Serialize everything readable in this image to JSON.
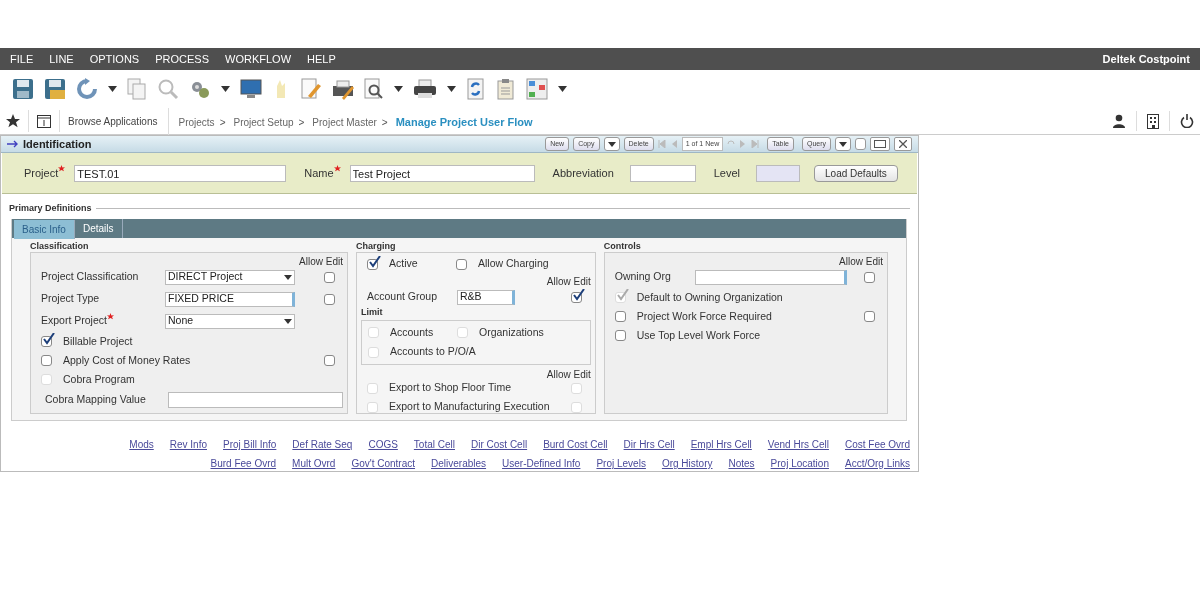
{
  "menu": [
    "FILE",
    "LINE",
    "OPTIONS",
    "PROCESS",
    "WORKFLOW",
    "HELP"
  ],
  "app_name": "Deltek Costpoint",
  "breadcrumb": {
    "browse": "Browse Applications",
    "path": [
      "Projects",
      "Project Setup",
      "Project Master"
    ],
    "separator": ">",
    "current": "Manage Project User Flow"
  },
  "identification": {
    "title": "Identification",
    "edit_buttons": [
      "New",
      "Copy",
      "Delete"
    ],
    "record": "1 of 1 New",
    "view_buttons": [
      "Table",
      "Query"
    ]
  },
  "header_fields": [
    {
      "label": "Project",
      "required": true,
      "value": "TEST.01",
      "disabled": false
    },
    {
      "label": "Name",
      "required": true,
      "value": "Test Project",
      "disabled": false
    },
    {
      "label": "Abbreviation",
      "required": false,
      "disabled": false
    },
    {
      "label": "Level",
      "required": false,
      "disabled": true
    }
  ],
  "load_defaults": "Load Defaults",
  "section_title": "Primary Definitions",
  "tabs": [
    {
      "label": "Basic Info",
      "selected": true
    },
    {
      "label": "Details",
      "selected": false
    }
  ],
  "groups": [
    {
      "title": "Classification",
      "rows": [
        {
          "kind": "header",
          "label": "Allow Edit"
        },
        {
          "kind": "select",
          "label": "Project Classification",
          "value": "DIRECT Project",
          "allow_edit": {
            "checked": false,
            "disabled": false
          }
        },
        {
          "kind": "text",
          "label": "Project Type",
          "value": "FIXED PRICE",
          "allow_edit": {
            "checked": false,
            "disabled": false
          }
        },
        {
          "kind": "select",
          "label": "Export Project",
          "required": true,
          "value": "None"
        },
        {
          "kind": "checkbox",
          "label": "Billable Project",
          "checked": true,
          "disabled": false
        },
        {
          "kind": "checkbox",
          "label": "Apply Cost of Money Rates",
          "checked": false,
          "disabled": false,
          "allow_edit": {
            "checked": false,
            "disabled": false
          }
        },
        {
          "kind": "checkbox",
          "label": "Cobra Program",
          "checked": false,
          "disabled": true
        },
        {
          "kind": "wide_text",
          "label": "Cobra Mapping Value"
        }
      ]
    },
    {
      "title": "Charging",
      "rows": [
        {
          "kind": "checkboxes",
          "items": [
            {
              "label": "Active",
              "checked": true,
              "disabled": false
            },
            {
              "label": "Allow Charging",
              "checked": false,
              "disabled": false
            }
          ]
        },
        {
          "kind": "header",
          "label": "Allow Edit"
        },
        {
          "kind": "text",
          "label": "Account Group",
          "value": "R&B",
          "allow_edit": {
            "checked": true,
            "disabled": false
          }
        },
        {
          "kind": "subgroup",
          "title": "Limit",
          "rows": [
            {
              "kind": "checkboxes",
              "items": [
                {
                  "label": "Accounts",
                  "checked": false,
                  "disabled": true
                },
                {
                  "label": "Organizations",
                  "checked": false,
                  "disabled": true
                }
              ]
            },
            {
              "kind": "checkbox",
              "label": "Accounts to P/O/A",
              "checked": false,
              "disabled": true
            }
          ]
        },
        {
          "kind": "header",
          "label": "Allow Edit"
        },
        {
          "kind": "checkbox",
          "label": "Export to Shop Floor Time",
          "checked": false,
          "disabled": true,
          "allow_edit": {
            "checked": false,
            "disabled": true
          }
        },
        {
          "kind": "checkbox",
          "label": "Export to Manufacturing Execution",
          "checked": false,
          "disabled": true,
          "allow_edit": {
            "checked": false,
            "disabled": true
          }
        }
      ]
    },
    {
      "title": "Controls",
      "rows": [
        {
          "kind": "header",
          "label": "Allow Edit"
        },
        {
          "kind": "text",
          "label": "Owning Org",
          "allow_edit": {
            "checked": false,
            "disabled": false
          }
        },
        {
          "kind": "checkbox",
          "label": "Default to Owning Organization",
          "checked": true,
          "disabled": true
        },
        {
          "kind": "checkbox",
          "label": "Project Work Force Required",
          "checked": false,
          "disabled": false,
          "allow_edit": {
            "checked": false,
            "disabled": false
          }
        },
        {
          "kind": "checkbox",
          "label": "Use Top Level Work Force",
          "checked": false,
          "disabled": false
        }
      ]
    }
  ],
  "links": [
    [
      "Mods",
      "Rev Info",
      "Proj Bill Info",
      "Def Rate Seq",
      "COGS",
      "Total Cell",
      "Dir Cost Cell",
      "Burd Cost Cell",
      "Dir Hrs Cell",
      "Empl Hrs Cell",
      "Vend Hrs Cell",
      "Cost Fee Ovrd"
    ],
    [
      "Burd Fee Ovrd",
      "Mult Ovrd",
      "Gov't Contract",
      "Deliverables",
      "User-Defined Info",
      "Proj Levels",
      "Org History",
      "Notes",
      "Proj Location",
      "Acct/Org Links"
    ]
  ]
}
